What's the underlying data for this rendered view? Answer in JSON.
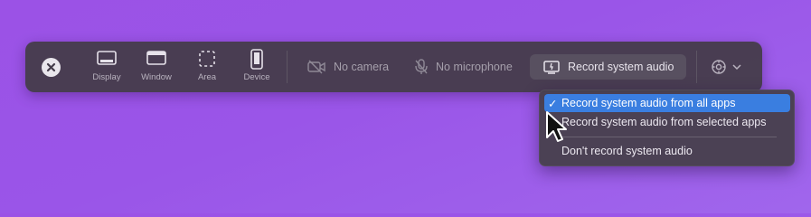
{
  "toolbar": {
    "modes": [
      {
        "label": "Display",
        "icon": "display-icon"
      },
      {
        "label": "Window",
        "icon": "window-icon"
      },
      {
        "label": "Area",
        "icon": "area-icon"
      },
      {
        "label": "Device",
        "icon": "device-icon"
      }
    ],
    "camera_label": "No camera",
    "microphone_label": "No microphone",
    "audio_label": "Record system audio"
  },
  "audio_menu": {
    "items": [
      {
        "label": "Record system audio from all apps",
        "checked": true
      },
      {
        "label": "Record system audio from selected apps",
        "checked": false
      },
      {
        "label": "Don't record system audio",
        "checked": false
      }
    ],
    "check_glyph": "✓"
  },
  "colors": {
    "background": "#9b52e6",
    "toolbar": "#443c4a",
    "highlight": "#3a7ee0"
  }
}
